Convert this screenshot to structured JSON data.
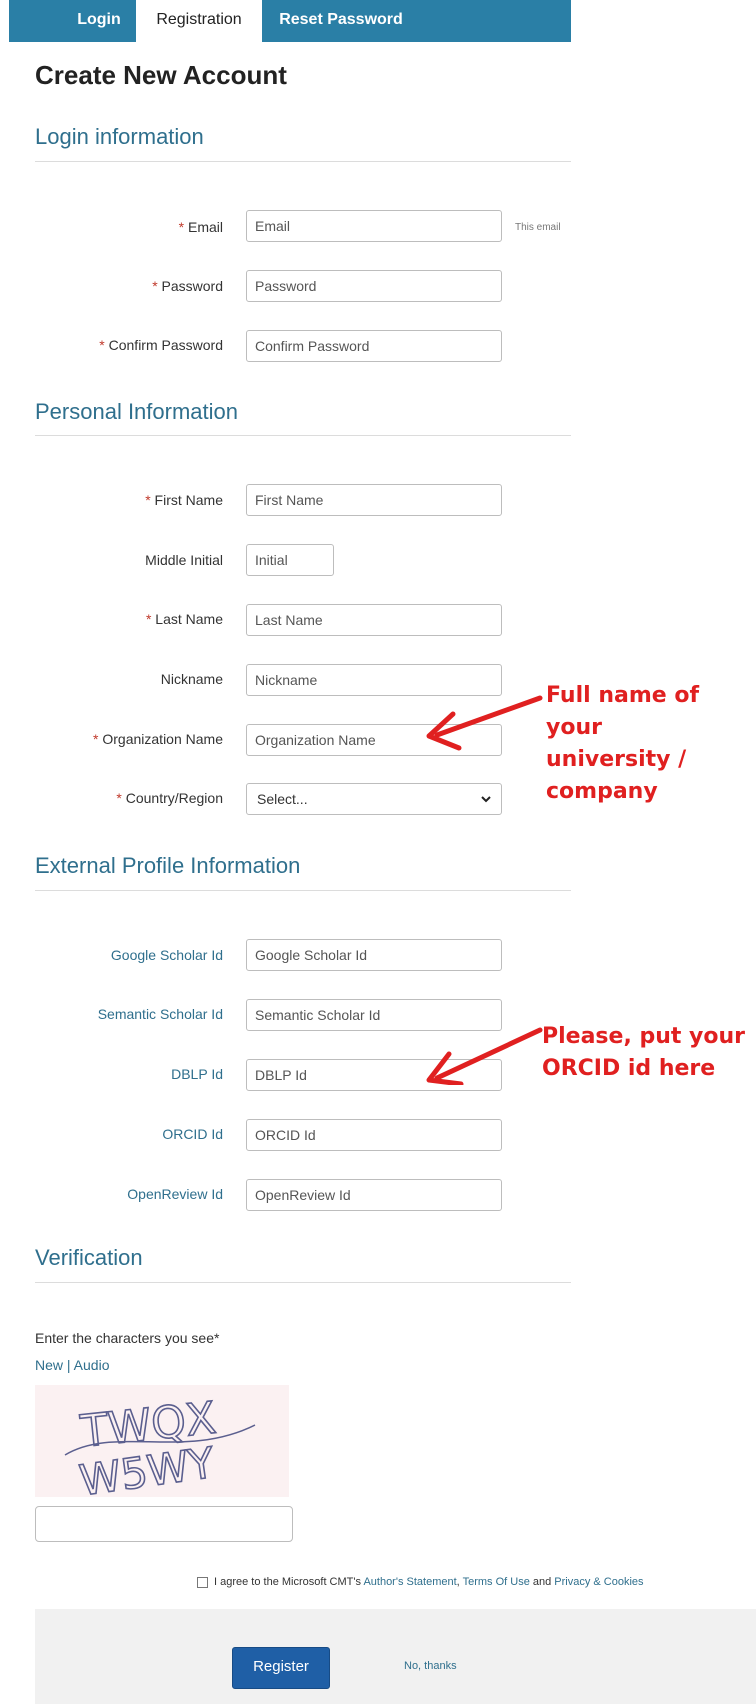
{
  "tabs": [
    {
      "label": "Login"
    },
    {
      "label": "Registration"
    },
    {
      "label": "Reset Password"
    }
  ],
  "page_title": "Create New Account",
  "sections": {
    "login": "Login information",
    "personal": "Personal Information",
    "external": "External Profile Information",
    "verification": "Verification"
  },
  "required_mark": "*",
  "fields": {
    "email": {
      "label": "Email",
      "placeholder": "Email",
      "hint": "This email"
    },
    "password": {
      "label": "Password",
      "placeholder": "Password"
    },
    "confirm_password": {
      "label": "Confirm Password",
      "placeholder": "Confirm Password"
    },
    "first_name": {
      "label": "First Name",
      "placeholder": "First Name"
    },
    "middle_initial": {
      "label": "Middle Initial",
      "placeholder": "Initial"
    },
    "last_name": {
      "label": "Last Name",
      "placeholder": "Last Name"
    },
    "nickname": {
      "label": "Nickname",
      "placeholder": "Nickname"
    },
    "organization": {
      "label": "Organization Name",
      "placeholder": "Organization Name"
    },
    "country": {
      "label": "Country/Region",
      "value": "Select..."
    },
    "google_scholar": {
      "label": "Google Scholar Id",
      "placeholder": "Google Scholar Id"
    },
    "semantic_scholar": {
      "label": "Semantic Scholar Id",
      "placeholder": "Semantic Scholar Id"
    },
    "dblp": {
      "label": "DBLP Id",
      "placeholder": "DBLP Id"
    },
    "orcid": {
      "label": "ORCID Id",
      "placeholder": "ORCID Id"
    },
    "openreview": {
      "label": "OpenReview Id",
      "placeholder": "OpenReview Id"
    }
  },
  "annotations": {
    "org_note_lines": [
      "Full name of",
      "your",
      "university /",
      "company"
    ],
    "orcid_note_lines": [
      "Please, put your",
      "ORCID id here"
    ],
    "color": "#e02020"
  },
  "verification": {
    "prompt": "Enter the characters you see*",
    "new_link": "New",
    "separator": "|",
    "audio_link": "Audio",
    "captcha_text_line1": "TWQX",
    "captcha_text_line2": "W5WY"
  },
  "agreement": {
    "prefix": "I agree to the Microsoft CMT's",
    "link1": "Author's Statement",
    "sep1": ",",
    "link2": "Terms Of Use",
    "and": "and",
    "link3": "Privacy & Cookies"
  },
  "footer": {
    "register_label": "Register",
    "no_thanks_label": "No, thanks"
  },
  "colors": {
    "tab_bar": "#2a7fa6",
    "section_title": "#2f6f8d",
    "register_button": "#1f5fa6",
    "required": "#c0392b"
  }
}
